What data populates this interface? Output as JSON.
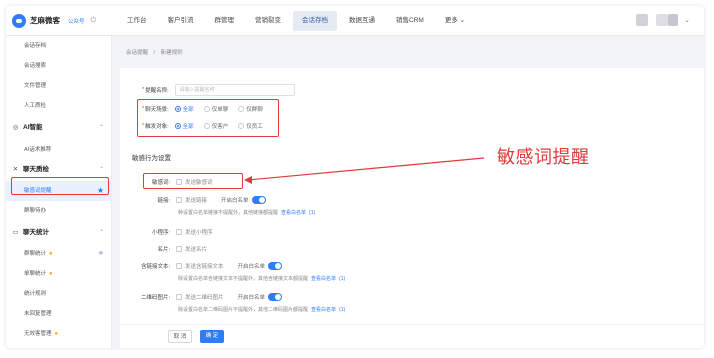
{
  "app": {
    "name": "芝麻微客",
    "tag": "公众号",
    "nav_tabs": [
      "工作台",
      "客户引流",
      "群管理",
      "营销裂变",
      "会话存档",
      "数据互通",
      "销售CRM",
      "更多"
    ],
    "active_tab": "会话存档"
  },
  "sidebar": {
    "items": [
      {
        "type": "item",
        "label": "会话存档"
      },
      {
        "type": "item",
        "label": "会话搜索"
      },
      {
        "type": "item",
        "label": "文件管理"
      },
      {
        "type": "item",
        "label": "人工质检"
      },
      {
        "type": "group",
        "label": "AI智能",
        "icon": "robot-icon"
      },
      {
        "type": "item",
        "label": "AI话术推荐"
      },
      {
        "type": "group",
        "label": "聊天质检",
        "icon": "check-icon"
      },
      {
        "type": "item",
        "label": "敏感词提醒",
        "active": true
      },
      {
        "type": "item",
        "label": "群聊待办"
      },
      {
        "type": "group",
        "label": "聊天统计",
        "icon": "chat-icon"
      },
      {
        "type": "item",
        "label": "群聊统计",
        "badge": "hot-icon"
      },
      {
        "type": "item",
        "label": "单聊统计",
        "badge": "hot-icon"
      },
      {
        "type": "item",
        "label": "统计规则"
      },
      {
        "type": "item",
        "label": "未回复管理"
      },
      {
        "type": "item",
        "label": "无效客管理",
        "badge": "hot-icon"
      }
    ]
  },
  "breadcrumb": [
    "会话提醒",
    "/",
    "新建规则"
  ],
  "form": {
    "rule_name_label": "提醒名称:",
    "rule_name_placeholder": "请输入提醒名称",
    "chat_scene_label": "聊天场景:",
    "chat_scene_options": [
      "全部",
      "仅单聊",
      "仅群聊"
    ],
    "chat_target_label": "触发对象:",
    "chat_target_options": [
      "全部",
      "仅客户",
      "仅员工"
    ],
    "section_title": "敏感行为设置",
    "sensitive_word_label": "敏感词:",
    "sensitive_word_option": "发送敏感词",
    "link_label": "链接:",
    "link_option": "发送链接",
    "whitelist_label": "开启白名单",
    "link_hint": "种设置白名单链接不提醒外，其他链接都提醒",
    "view_whitelist": "查看白名单",
    "link_count": "(1)",
    "miniapp_label": "小程序:",
    "miniapp_option": "发送小程序",
    "card_label": "名片:",
    "card_option": "发送名片",
    "text_link_label": "含链接文本:",
    "text_link_option": "发送含链接文本",
    "text_link_hint": "除设置白名单含链接文本不提醒外，其他含链接文本都提醒",
    "text_link_count": "(1)",
    "qr_label": "二维码图片:",
    "qr_option": "发送二维码图片",
    "qr_hint": "除设置白名单二维码图片不提醒外，其他二维码图片都提醒",
    "qr_count": "(1)"
  },
  "footer": {
    "cancel": "取 消",
    "confirm": "确 定"
  },
  "annotation": {
    "text": "敏感词提醒",
    "color": "#e03a3a"
  },
  "colors": {
    "accent": "#2f7cf6",
    "highlight": "#e03a3a"
  }
}
